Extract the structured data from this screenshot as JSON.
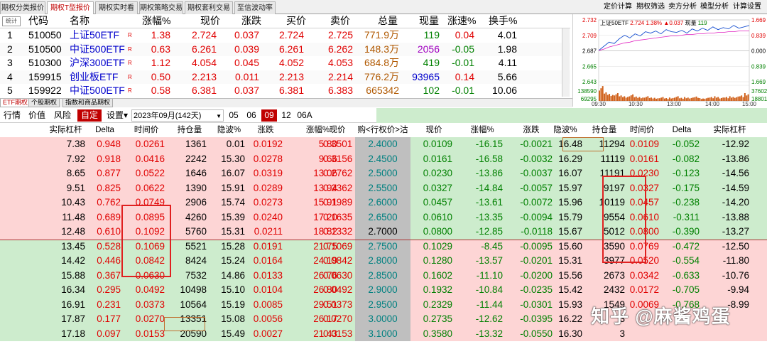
{
  "tabs": [
    "期权分类报价",
    "期权T型报价",
    "期权实时看盘",
    "期权策略交易",
    "期权套利交易",
    "至信波动率"
  ],
  "right_links": [
    "定价计算",
    "期权筛选",
    "卖方分析",
    "模型分析",
    "计算设置"
  ],
  "quote_headers": [
    "代码",
    "名称",
    "涨幅%",
    "现价",
    "涨跌",
    "买价",
    "卖价",
    "总量",
    "现量",
    "涨速%",
    "换手%"
  ],
  "quotes": [
    {
      "no": "1",
      "code": "510050",
      "name": "上证50ETF",
      "r": "R",
      "pct": "1.38",
      "price": "2.724",
      "chg": "0.037",
      "bid": "2.724",
      "ask": "2.725",
      "vol": "771.9万",
      "cur": "119",
      "speed": "0.04",
      "turn": "4.01"
    },
    {
      "no": "2",
      "code": "510500",
      "name": "中证500ETF",
      "r": "R",
      "pct": "0.63",
      "price": "6.261",
      "chg": "0.039",
      "bid": "6.261",
      "ask": "6.262",
      "vol": "148.3万",
      "cur": "2056",
      "speed": "-0.05",
      "turn": "1.98"
    },
    {
      "no": "3",
      "code": "510300",
      "name": "沪深300ETF",
      "r": "R",
      "pct": "1.12",
      "price": "4.054",
      "chg": "0.045",
      "bid": "4.052",
      "ask": "4.053",
      "vol": "684.8万",
      "cur": "419",
      "speed": "-0.01",
      "turn": "4.11"
    },
    {
      "no": "4",
      "code": "159915",
      "name": "创业板ETF",
      "r": "R",
      "pct": "0.50",
      "price": "2.213",
      "chg": "0.011",
      "bid": "2.213",
      "ask": "2.214",
      "vol": "776.2万",
      "cur": "93965",
      "speed": "0.14",
      "turn": "5.66"
    },
    {
      "no": "5",
      "code": "159922",
      "name": "中证500ETF",
      "r": "R",
      "pct": "0.58",
      "price": "6.381",
      "chg": "0.037",
      "bid": "6.381",
      "ask": "6.383",
      "vol": "665342",
      "cur": "102",
      "speed": "-0.01",
      "turn": "10.06"
    }
  ],
  "mini_chart": {
    "title": "上证50ETF",
    "price": "2.724",
    "pct": "1.38%",
    "chg": "▲0.037",
    "cur_label": "现量",
    "cur": "119",
    "y_left": [
      "2.732",
      "2.709",
      "2.687",
      "2.665",
      "2.643",
      "138590",
      "69295"
    ],
    "y_right": [
      "1.669",
      "0.839",
      "0.000",
      "0.839",
      "1.669",
      "37602",
      "18801"
    ],
    "x": [
      "09:30",
      "10:30",
      "13:00",
      "14:00",
      "15:00"
    ],
    "price_series": [
      2.688,
      2.694,
      2.7,
      2.698,
      2.705,
      2.71,
      2.706,
      2.712,
      2.709,
      2.715,
      2.713,
      2.716,
      2.712,
      2.718,
      2.715,
      2.714,
      2.717,
      2.713,
      2.719,
      2.716,
      2.72,
      2.717,
      2.722,
      2.718,
      2.721,
      2.719,
      2.724,
      2.72,
      2.722,
      2.724
    ],
    "avg_series": [
      2.688,
      2.69,
      2.693,
      2.695,
      2.697,
      2.699,
      2.7,
      2.702,
      2.703,
      2.704,
      2.705,
      2.706,
      2.707,
      2.708,
      2.709,
      2.709,
      2.71,
      2.711,
      2.711,
      2.712,
      2.712,
      2.713,
      2.713,
      2.714,
      2.714,
      2.715,
      2.715,
      2.716,
      2.716,
      2.716
    ],
    "vol_series": [
      0.95,
      0.55,
      0.45,
      0.5,
      0.35,
      0.3,
      0.42,
      0.28,
      0.25,
      0.3,
      0.22,
      0.2,
      0.25,
      0.18,
      0.22,
      0.3,
      0.2,
      0.25,
      0.22,
      0.28,
      0.18,
      0.2,
      0.25,
      0.3,
      0.22,
      0.25,
      0.3,
      0.28,
      0.35,
      0.5
    ]
  },
  "bottom_tabs": [
    "ETF期权",
    "个股期权",
    "指数和商品期权"
  ],
  "toolbar": {
    "items": [
      "行情",
      "价值",
      "风险"
    ],
    "selected": "自定",
    "settings": "设置▾",
    "month_select": "2023年09月(142天)",
    "dropdown": "▼",
    "months": [
      "05",
      "06",
      "09",
      "12",
      "06A"
    ],
    "active_month": "09"
  },
  "option_headers": {
    "left": [
      "实际杠杆",
      "Delta",
      "时间价",
      "持仓量",
      "隐波%",
      "涨跌",
      "涨幅%",
      "现价"
    ],
    "mid": "购<行权价>沽",
    "right": [
      "现价",
      "涨幅%",
      "涨跌",
      "隐波%",
      "持仓量",
      "时间价",
      "Delta",
      "实际杠杆"
    ]
  },
  "options": [
    {
      "l": [
        "7.38",
        "0.948",
        "0.0261",
        "1361",
        "0.01",
        "0.0192",
        "5.80",
        "0.3501"
      ],
      "k": "2.4000",
      "r": [
        "0.0109",
        "-16.15",
        "-0.0021",
        "16.48",
        "11294",
        "0.0109",
        "-0.052",
        "-12.92"
      ]
    },
    {
      "l": [
        "7.92",
        "0.918",
        "0.0416",
        "2242",
        "15.30",
        "0.0278",
        "9.66",
        "0.3156"
      ],
      "k": "2.4500",
      "r": [
        "0.0161",
        "-16.58",
        "-0.0032",
        "16.29",
        "11119",
        "0.0161",
        "-0.082",
        "-13.86"
      ]
    },
    {
      "l": [
        "8.65",
        "0.877",
        "0.0522",
        "1646",
        "16.07",
        "0.0319",
        "13.06",
        "0.2762"
      ],
      "k": "2.5000",
      "r": [
        "0.0230",
        "-13.86",
        "-0.0037",
        "16.07",
        "11191",
        "0.0230",
        "-0.123",
        "-14.56"
      ]
    },
    {
      "l": [
        "9.51",
        "0.825",
        "0.0622",
        "1390",
        "15.91",
        "0.0289",
        "13.94",
        "0.2362"
      ],
      "k": "2.5500",
      "r": [
        "0.0327",
        "-14.84",
        "-0.0057",
        "15.97",
        "9197",
        "0.0327",
        "-0.175",
        "-14.59"
      ]
    },
    {
      "l": [
        "10.43",
        "0.762",
        "0.0749",
        "2906",
        "15.74",
        "0.0273",
        "15.91",
        "0.1989"
      ],
      "k": "2.6000",
      "r": [
        "0.0457",
        "-13.61",
        "-0.0072",
        "15.96",
        "10119",
        "0.0457",
        "-0.238",
        "-14.20"
      ]
    },
    {
      "l": [
        "11.48",
        "0.689",
        "0.0895",
        "4260",
        "15.39",
        "0.0240",
        "17.20",
        "0.1635"
      ],
      "k": "2.6500",
      "r": [
        "0.0610",
        "-13.35",
        "-0.0094",
        "15.79",
        "9554",
        "0.0610",
        "-0.311",
        "-13.88"
      ]
    },
    {
      "l": [
        "12.48",
        "0.610",
        "0.1092",
        "5760",
        "15.31",
        "0.0211",
        "18.82",
        "0.1332"
      ],
      "k": "2.7000",
      "r": [
        "0.0800",
        "-12.85",
        "-0.0118",
        "15.67",
        "5012",
        "0.0800",
        "-0.390",
        "-13.27"
      ]
    },
    {
      "l": [
        "13.45",
        "0.528",
        "0.1069",
        "5521",
        "15.28",
        "0.0191",
        "21.75",
        "0.1069"
      ],
      "k": "2.7500",
      "r": [
        "0.1029",
        "-8.45",
        "-0.0095",
        "15.60",
        "3590",
        "0.0769",
        "-0.472",
        "-12.50"
      ]
    },
    {
      "l": [
        "14.42",
        "0.446",
        "0.0842",
        "8424",
        "15.24",
        "0.0164",
        "24.19",
        "0.0842"
      ],
      "k": "2.8000",
      "r": [
        "0.1280",
        "-13.57",
        "-0.0201",
        "15.31",
        "3977",
        "0.0520",
        "-0.554",
        "-11.80"
      ]
    },
    {
      "l": [
        "15.88",
        "0.367",
        "0.0630",
        "7532",
        "14.86",
        "0.0133",
        "26.76",
        "0.0630"
      ],
      "k": "2.8500",
      "r": [
        "0.1602",
        "-11.10",
        "-0.0200",
        "15.56",
        "2673",
        "0.0342",
        "-0.633",
        "-10.76"
      ]
    },
    {
      "l": [
        "16.34",
        "0.295",
        "0.0492",
        "10498",
        "15.10",
        "0.0104",
        "26.80",
        "0.0492"
      ],
      "k": "2.9000",
      "r": [
        "0.1932",
        "-10.84",
        "-0.0235",
        "15.42",
        "2432",
        "0.0172",
        "-0.705",
        "-9.94"
      ]
    },
    {
      "l": [
        "16.91",
        "0.231",
        "0.0373",
        "10564",
        "15.19",
        "0.0085",
        "29.51",
        "0.0373"
      ],
      "k": "2.9500",
      "r": [
        "0.2329",
        "-11.44",
        "-0.0301",
        "15.93",
        "1549",
        "0.0069",
        "-0.768",
        "-8.99"
      ]
    },
    {
      "l": [
        "17.87",
        "0.177",
        "0.0270",
        "13351",
        "15.08",
        "0.0056",
        "26.17",
        "0.0270"
      ],
      "k": "3.0000",
      "r": [
        "0.2735",
        "-12.62",
        "-0.0395",
        "16.22",
        "3",
        "",
        "",
        ""
      ]
    },
    {
      "l": [
        "17.18",
        "0.097",
        "0.0153",
        "20590",
        "15.49",
        "0.0027",
        "21.43",
        "0.0153"
      ],
      "k": "3.1000",
      "r": [
        "0.3580",
        "-13.32",
        "-0.0550",
        "16.30",
        "3",
        "",
        "",
        ""
      ]
    }
  ],
  "watermark": "知乎 @麻酱鸡蛋"
}
